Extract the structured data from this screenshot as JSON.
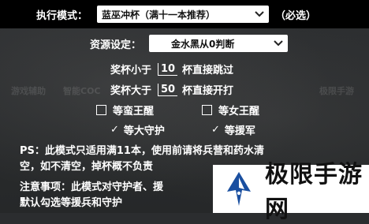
{
  "mode": {
    "label": "执行模式：",
    "value": "蓝巫冲杯（满十一本推荐）",
    "required": "（必选）"
  },
  "resource": {
    "label": "资源设定：",
    "value": "金水黑从0判断"
  },
  "trophy_less": {
    "prefix": "奖杯小于",
    "value": "10",
    "suffix": "杯直接跳过"
  },
  "trophy_more": {
    "prefix": "奖杯大于",
    "value": "50",
    "suffix": "杯直接开打"
  },
  "checkboxes": [
    {
      "label": "等蛮王醒",
      "checked": false
    },
    {
      "label": "等女王醒",
      "checked": false
    },
    {
      "label": "等大守护",
      "checked": true
    },
    {
      "label": "等援军",
      "checked": true
    }
  ],
  "ps_note": {
    "line1": "PS：此模式只适用满11本，使用前请将兵营和药水清",
    "line2": "空，如不清空，掉杯概不负责"
  },
  "notice": {
    "line1": "注意事项：此模式对守护者、援",
    "line2": "默认勾选等援兵和守护"
  },
  "ghost_labels": [
    "游戏辅助",
    "智能COC",
    "极限手游"
  ],
  "watermark": {
    "text": "极限手游网",
    "brand_color": "#1a4fa0"
  },
  "colors": {
    "background": "#2b2d2f",
    "top_bar": "#000000",
    "text": "#ffffff"
  }
}
